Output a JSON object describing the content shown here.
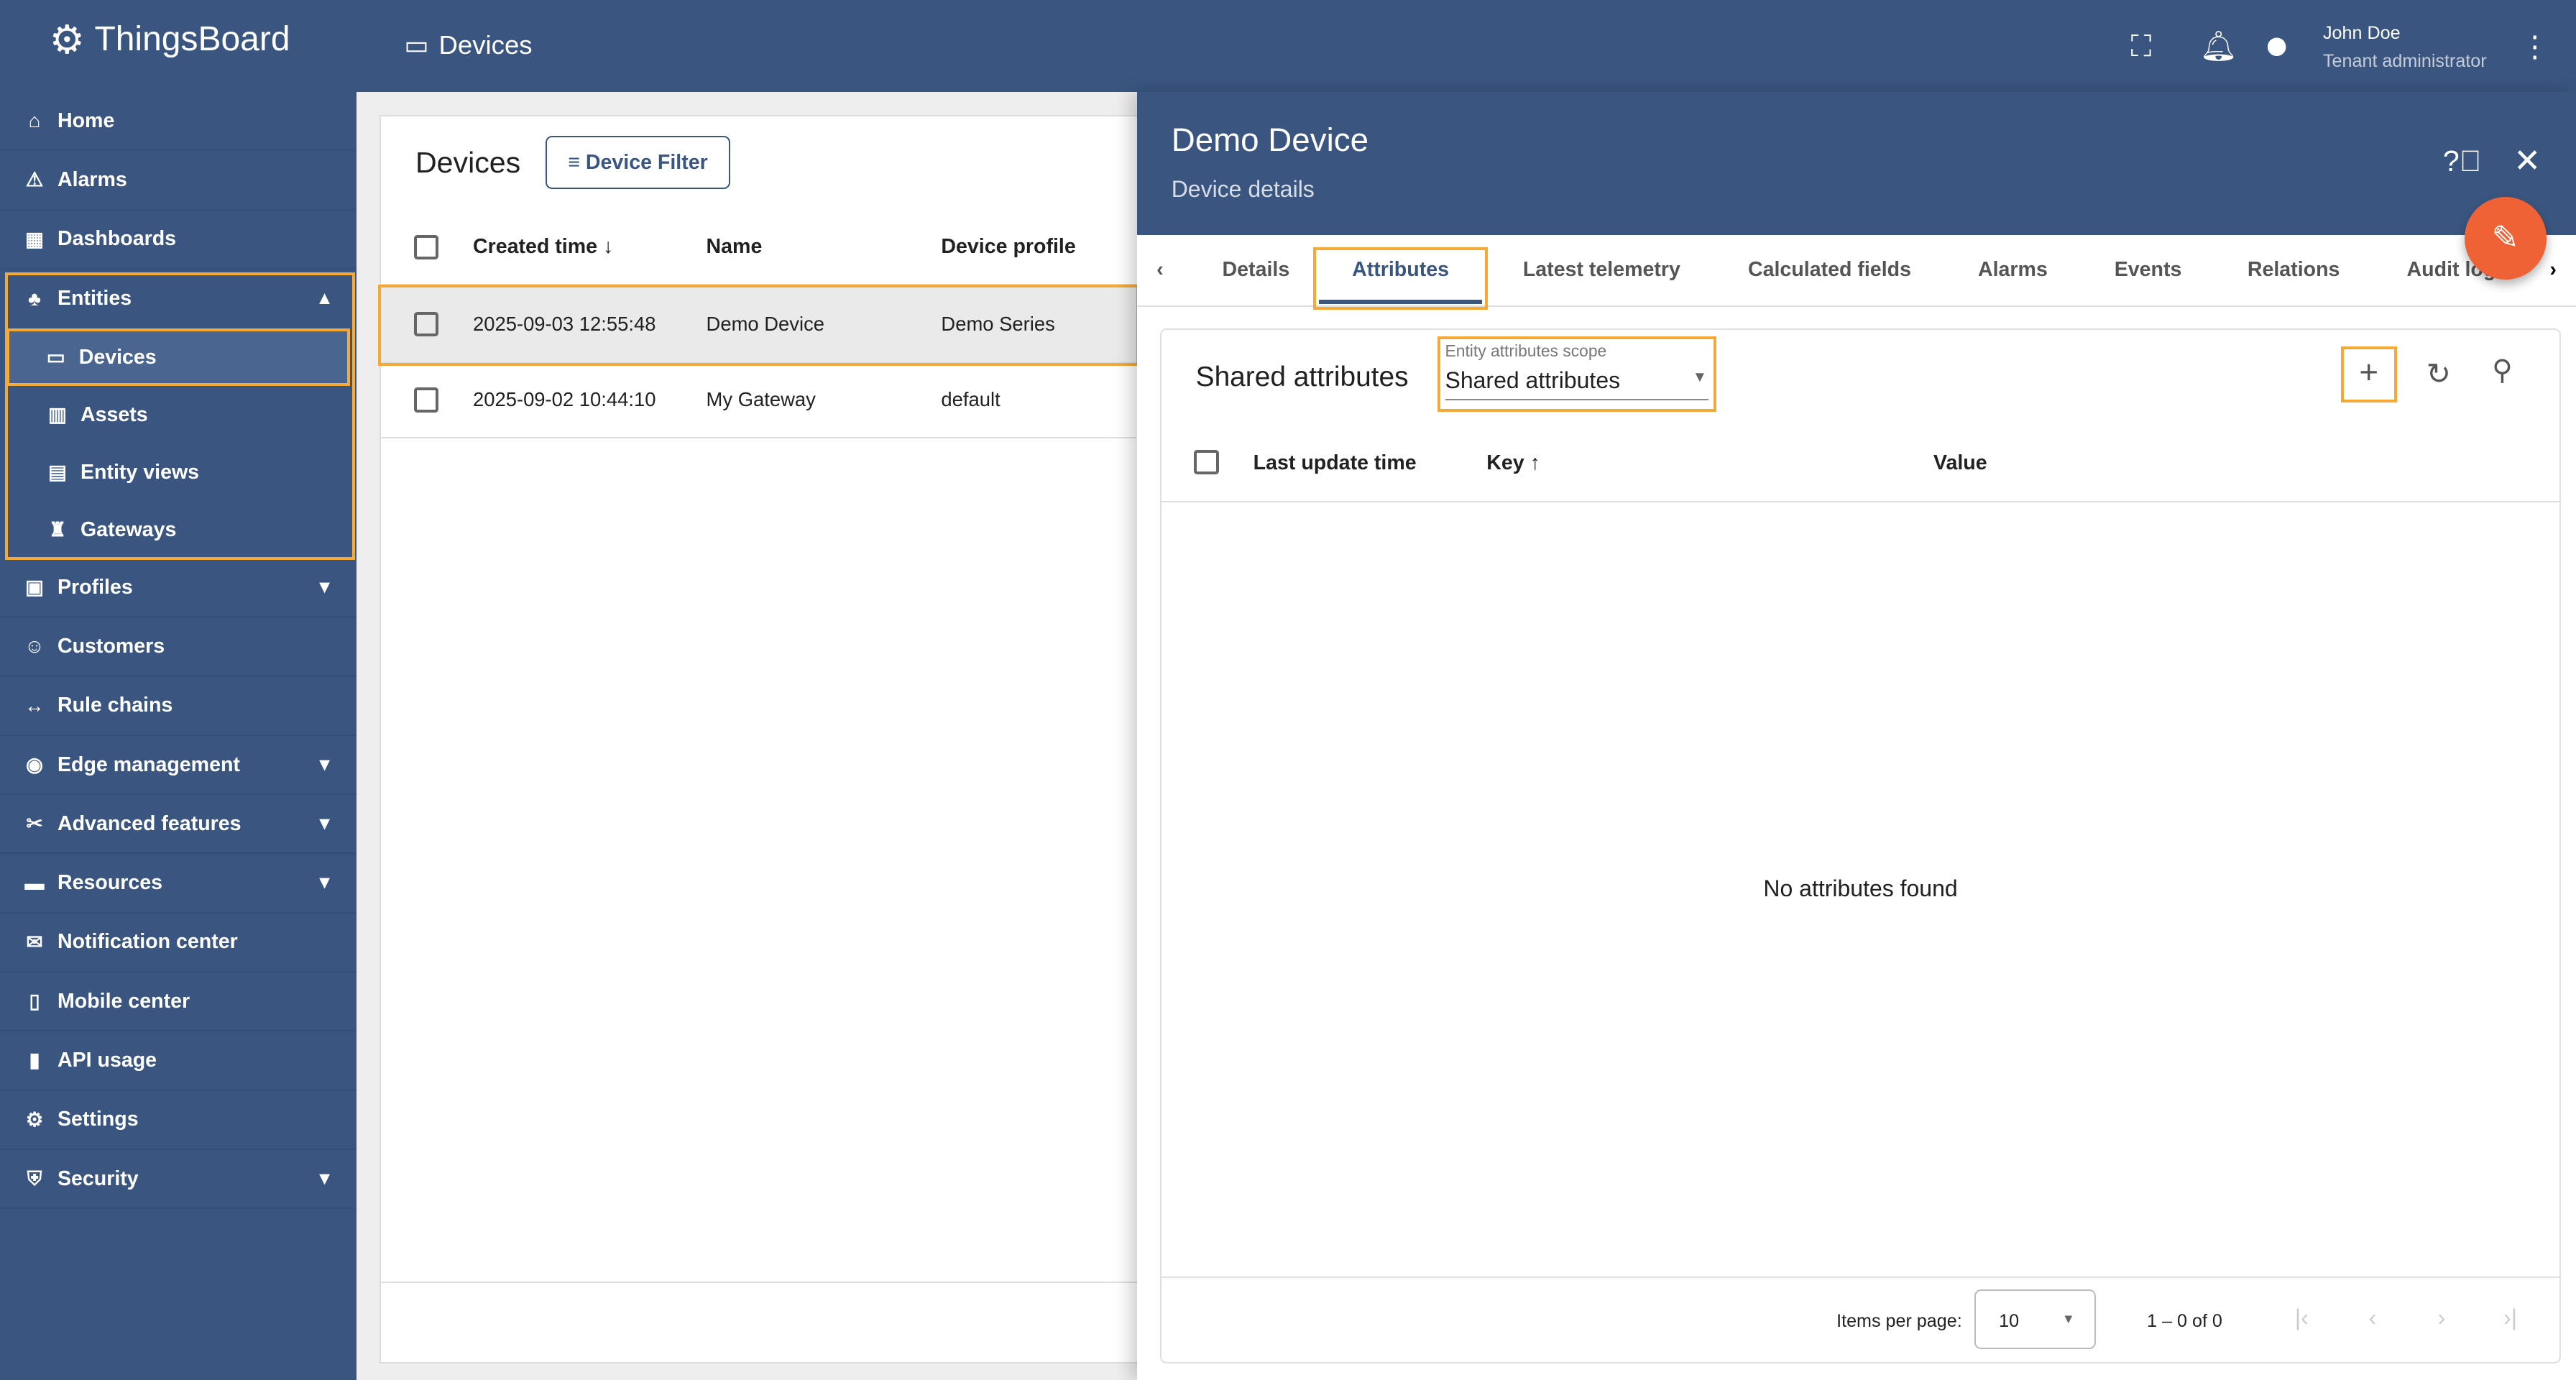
{
  "header": {
    "brand": "ThingsBoard",
    "breadcrumb": "Devices",
    "user_name": "John Doe",
    "user_role": "Tenant administrator"
  },
  "sidebar": {
    "items": [
      {
        "label": "Home",
        "icon": "⌂",
        "name": "home"
      },
      {
        "label": "Alarms",
        "icon": "⚠",
        "name": "alarms"
      },
      {
        "label": "Dashboards",
        "icon": "▦",
        "name": "dashboards"
      },
      {
        "label": "Entities",
        "icon": "♣",
        "name": "entities",
        "chev": "▲"
      },
      {
        "label": "Devices",
        "icon": "▭",
        "name": "devices",
        "sub": true,
        "active": true
      },
      {
        "label": "Assets",
        "icon": "▥",
        "name": "assets",
        "sub": true
      },
      {
        "label": "Entity views",
        "icon": "▤",
        "name": "entity-views",
        "sub": true
      },
      {
        "label": "Gateways",
        "icon": "♜",
        "name": "gateways",
        "sub": true
      },
      {
        "label": "Profiles",
        "icon": "▣",
        "name": "profiles",
        "chev": "▼"
      },
      {
        "label": "Customers",
        "icon": "☺",
        "name": "customers"
      },
      {
        "label": "Rule chains",
        "icon": "↔",
        "name": "rule-chains"
      },
      {
        "label": "Edge management",
        "icon": "◉",
        "name": "edge-management",
        "chev": "▼"
      },
      {
        "label": "Advanced features",
        "icon": "✂",
        "name": "advanced-features",
        "chev": "▼"
      },
      {
        "label": "Resources",
        "icon": "▬",
        "name": "resources",
        "chev": "▼"
      },
      {
        "label": "Notification center",
        "icon": "✉",
        "name": "notification-center"
      },
      {
        "label": "Mobile center",
        "icon": "▯",
        "name": "mobile-center"
      },
      {
        "label": "API usage",
        "icon": "▮",
        "name": "api-usage"
      },
      {
        "label": "Settings",
        "icon": "⚙",
        "name": "settings"
      },
      {
        "label": "Security",
        "icon": "⛨",
        "name": "security",
        "chev": "▼"
      }
    ]
  },
  "devices": {
    "title": "Devices",
    "filter_label": "Device Filter",
    "columns": [
      "Created time",
      "Name",
      "Device profile"
    ],
    "sort_icon": "↓",
    "rows": [
      [
        "2025-09-03 12:55:48",
        "Demo Device",
        "Demo Series"
      ],
      [
        "2025-09-02 10:44:10",
        "My Gateway",
        "default"
      ]
    ]
  },
  "details": {
    "title": "Demo Device",
    "subtitle": "Device details",
    "tabs": [
      "Details",
      "Attributes",
      "Latest telemetry",
      "Calculated fields",
      "Alarms",
      "Events",
      "Relations",
      "Audit logs"
    ],
    "active_tab": "Attributes",
    "section_title": "Shared attributes",
    "scope_label": "Entity attributes scope",
    "scope_value": "Shared attributes",
    "columns": [
      "Last update time",
      "Key",
      "Value"
    ],
    "key_sort_icon": "↑",
    "empty": "No attributes found",
    "items_per_page_label": "Items per page:",
    "items_per_page": "10",
    "range": "1 – 0 of 0"
  },
  "colors": {
    "primary": "#3a5680",
    "highlight": "#f5a937",
    "fab": "#ee6236"
  }
}
